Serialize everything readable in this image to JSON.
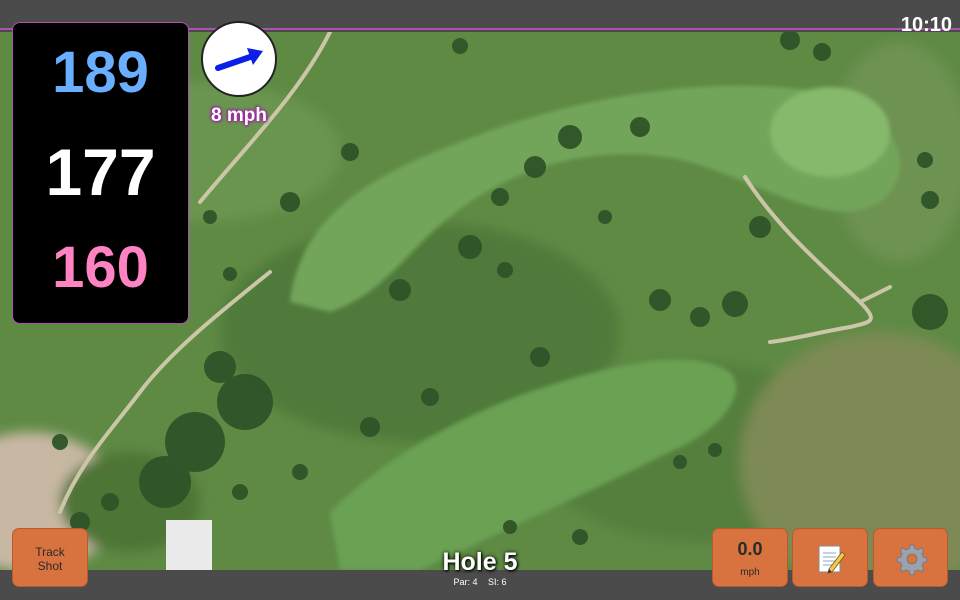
{
  "status_bar": {
    "time": "10:10"
  },
  "distances": {
    "back": "189",
    "middle": "177",
    "front": "160"
  },
  "colors": {
    "back": "#6aaeff",
    "middle": "#ffffff",
    "front": "#ff82c3",
    "accent": "#b04fb6",
    "button": "#d8733f"
  },
  "wind": {
    "speed": "8 mph",
    "arrow_icon": "wind-arrow-icon"
  },
  "buttons": {
    "track_shot": {
      "line1": "Track",
      "line2": "Shot"
    },
    "speed": {
      "value": "0.0",
      "unit": "mph"
    },
    "notes_icon": "notepad-icon",
    "settings_icon": "gear-icon"
  },
  "hole": {
    "title": "Hole 5",
    "par": "Par: 4",
    "si": "SI: 6"
  }
}
